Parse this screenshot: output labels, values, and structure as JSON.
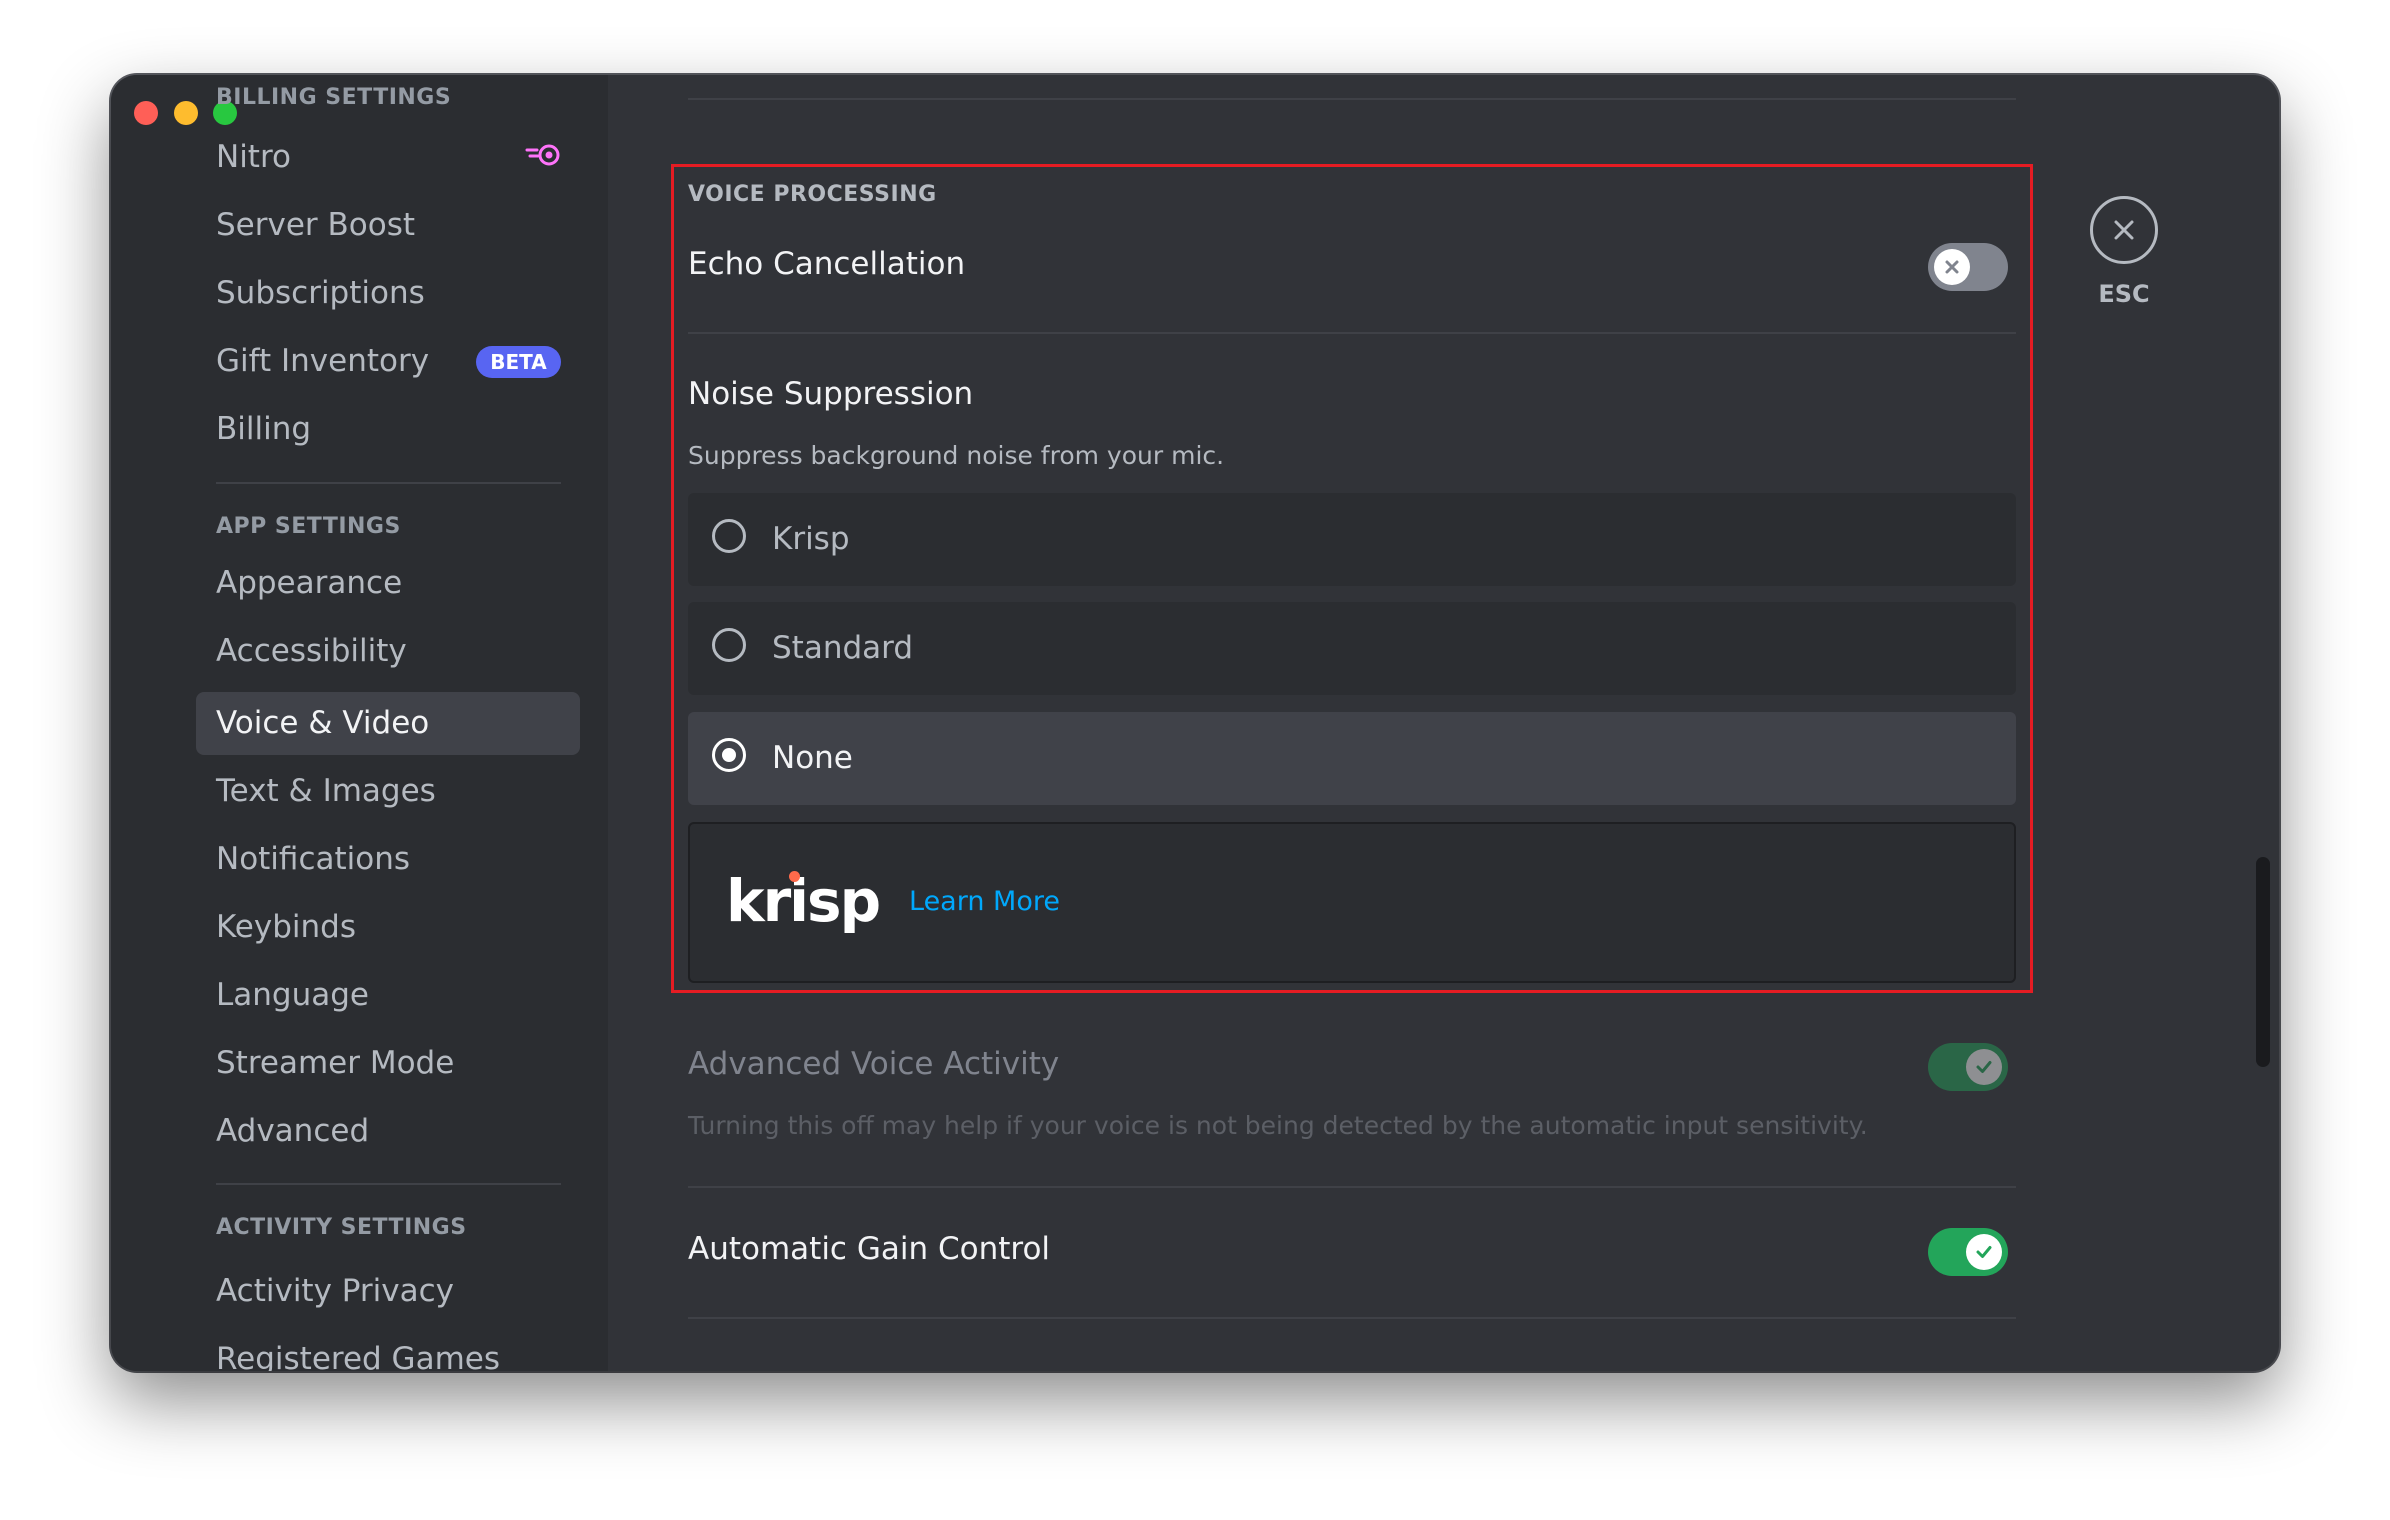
{
  "sidebar": {
    "billing_header": "BILLING SETTINGS",
    "billing_items": [
      {
        "label": "Nitro",
        "icon": "nitro-icon"
      },
      {
        "label": "Server Boost"
      },
      {
        "label": "Subscriptions"
      },
      {
        "label": "Gift Inventory",
        "badge": "BETA"
      },
      {
        "label": "Billing"
      }
    ],
    "app_header": "APP SETTINGS",
    "app_items": [
      {
        "label": "Appearance"
      },
      {
        "label": "Accessibility"
      },
      {
        "label": "Voice & Video",
        "active": true
      },
      {
        "label": "Text & Images"
      },
      {
        "label": "Notifications"
      },
      {
        "label": "Keybinds"
      },
      {
        "label": "Language"
      },
      {
        "label": "Streamer Mode"
      },
      {
        "label": "Advanced"
      }
    ],
    "activity_header": "ACTIVITY SETTINGS",
    "activity_items": [
      {
        "label": "Activity Privacy"
      },
      {
        "label": "Registered Games"
      }
    ]
  },
  "voice_processing": {
    "section_title": "VOICE PROCESSING",
    "echo_cancellation": {
      "label": "Echo Cancellation",
      "enabled": false
    },
    "noise_suppression": {
      "label": "Noise Suppression",
      "description": "Suppress background noise from your mic.",
      "options": [
        "Krisp",
        "Standard",
        "None"
      ],
      "selected": "None"
    },
    "krisp_promo": {
      "logo": "krisp",
      "link": "Learn More"
    }
  },
  "advanced_voice_activity": {
    "label": "Advanced Voice Activity",
    "description": "Turning this off may help if your voice is not being detected by the automatic input sensitivity.",
    "enabled": true,
    "disabled_state": true
  },
  "automatic_gain_control": {
    "label": "Automatic Gain Control",
    "enabled": true
  },
  "close": {
    "label": "ESC"
  },
  "colors": {
    "accent": "#5865f2",
    "toggle_on": "#23a55a",
    "link": "#00a8fc",
    "highlight": "#e51c23"
  }
}
